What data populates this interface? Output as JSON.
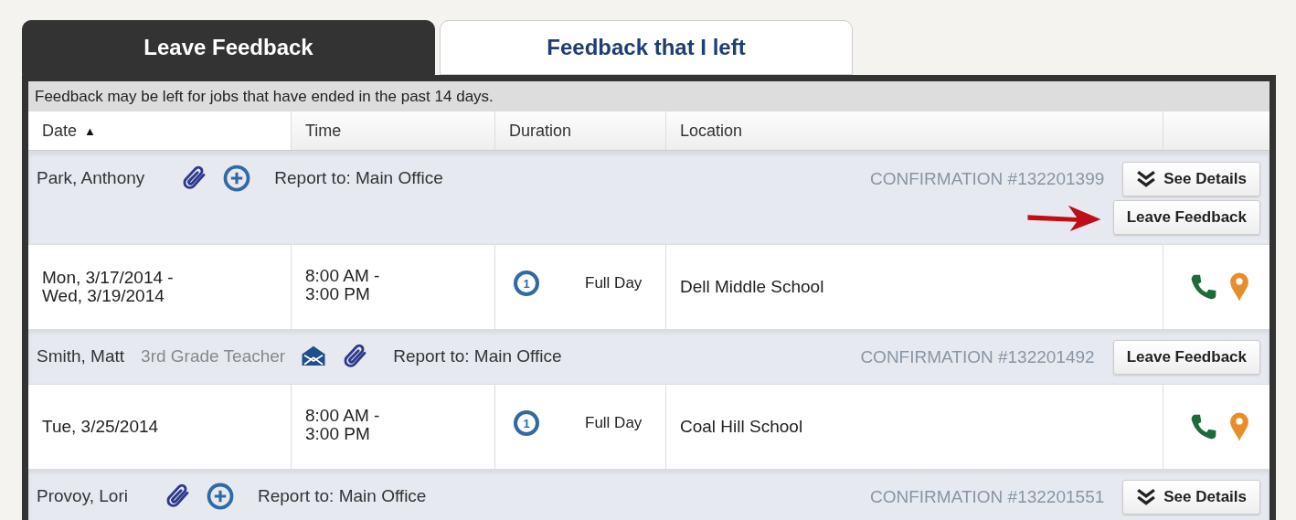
{
  "tabs": [
    {
      "label": "Leave Feedback",
      "selected": true
    },
    {
      "label": "Feedback that I left",
      "selected": false
    }
  ],
  "notice": "Feedback may be left for jobs that have ended in the past 14 days.",
  "columns": [
    {
      "label": "Date",
      "sort": "▲"
    },
    {
      "label": "Time"
    },
    {
      "label": "Duration"
    },
    {
      "label": "Location"
    }
  ],
  "jobs": [
    {
      "name": "Park, Anthony",
      "icons": [
        {
          "kind": "paperclip"
        },
        {
          "kind": "plus"
        }
      ],
      "report_to": "Report to: Main Office",
      "confirmation": "CONFIRMATION #132201399",
      "buttons": [
        {
          "kind": "details",
          "label": "See Details"
        },
        {
          "kind": "feedback",
          "label": "Leave Feedback",
          "pointer": true
        }
      ],
      "date": "Mon, 3/17/2014 - Wed, 3/19/2014",
      "time": "8:00 AM - 3:00 PM",
      "duration_badge": "1",
      "duration": "Full Day",
      "location": "Dell Middle School"
    },
    {
      "name": "Smith, Matt",
      "title": "3rd Grade Teacher",
      "icons": [
        {
          "kind": "envelope"
        },
        {
          "kind": "paperclip"
        }
      ],
      "report_to": "Report to: Main Office",
      "confirmation": "CONFIRMATION #132201492",
      "buttons": [
        {
          "kind": "feedback",
          "label": "Leave Feedback",
          "pointer": false
        }
      ],
      "date": "Tue, 3/25/2014",
      "time": "8:00 AM - 3:00 PM",
      "duration_badge": "1",
      "duration": "Full Day",
      "location": "Coal Hill School"
    },
    {
      "name": "Provoy, Lori",
      "icons": [
        {
          "kind": "paperclip"
        },
        {
          "kind": "plus"
        }
      ],
      "report_to": "Report to: Main Office",
      "confirmation": "CONFIRMATION #132201551",
      "buttons": [
        {
          "kind": "details",
          "label": "See Details"
        }
      ]
    }
  ]
}
